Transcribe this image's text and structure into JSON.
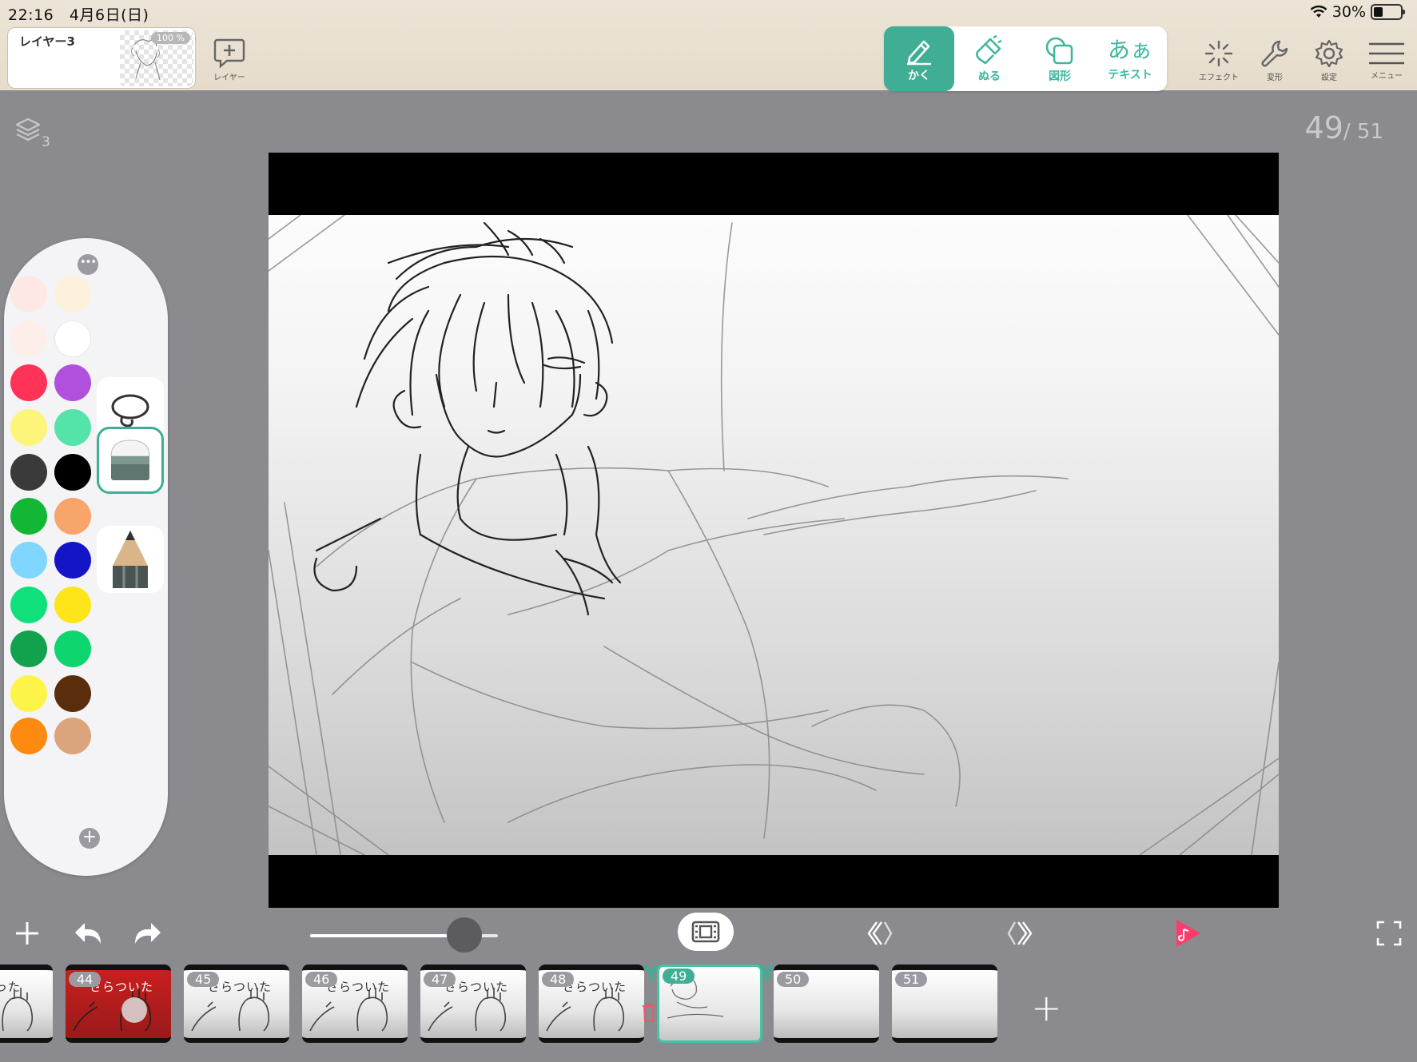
{
  "status_bar": {
    "time": "22:16",
    "date": "4月6日(日)",
    "battery": "30%"
  },
  "layer_card": {
    "name": "レイヤー3",
    "opacity": "100 %"
  },
  "top_buttons": {
    "add_layer_label": "レイヤー",
    "effect_label": "エフェクト",
    "transform_label": "変形",
    "settings_label": "設定",
    "menu_label": "メニュー"
  },
  "tools": [
    {
      "label": "かく",
      "icon": "pen-icon",
      "active": true
    },
    {
      "label": "ぬる",
      "icon": "brush-icon",
      "active": false
    },
    {
      "label": "図形",
      "icon": "shape-icon",
      "active": false
    },
    {
      "label": "テキスト",
      "glyph": "あぁ",
      "icon": "text-icon",
      "active": false
    }
  ],
  "canvas_header": {
    "layer_count": "3",
    "current_frame": "49",
    "total_frames": "/ 51"
  },
  "palette": {
    "colors": [
      [
        "#fde8e4",
        "#fdf0dc"
      ],
      [
        "#fdeeea",
        "#ffffff"
      ],
      [
        "#ff3358",
        "#b150dc"
      ],
      [
        "#fdf57a",
        "#54e3a8"
      ],
      [
        "#3a3a3a",
        "#000000"
      ],
      [
        "#12b835",
        "#f7a56a"
      ],
      [
        "#7fd6ff",
        "#1515c8"
      ],
      [
        "#10e07c",
        "#fde51a"
      ],
      [
        "#12a24e",
        "#0fd56f"
      ],
      [
        "#fdf44a",
        "#5a2d0c"
      ],
      [
        "#ff8a10",
        "#dca47c"
      ]
    ],
    "brushes": [
      "lasso-icon",
      "eraser-icon",
      "pencil-icon"
    ],
    "selected_brush": "eraser-icon"
  },
  "playback": {
    "speed": 0.82
  },
  "frames": [
    {
      "num": "",
      "caption": "った",
      "style": "plain"
    },
    {
      "num": "44",
      "caption": "さらついた",
      "style": "red"
    },
    {
      "num": "45",
      "caption": "さらついた",
      "style": "plain"
    },
    {
      "num": "46",
      "caption": "さらついた",
      "style": "plain"
    },
    {
      "num": "47",
      "caption": "さらついた",
      "style": "plain"
    },
    {
      "num": "48",
      "caption": "さらついた",
      "style": "plain"
    },
    {
      "num": "49",
      "caption": "",
      "style": "current"
    },
    {
      "num": "50",
      "caption": "",
      "style": "blank"
    },
    {
      "num": "51",
      "caption": "",
      "style": "blank"
    }
  ],
  "colors": {
    "accent": "#3fae94",
    "toolbar_bg": "#e8e0d0",
    "workspace_bg": "#8a8a8f",
    "play": "#ff3b6a"
  }
}
